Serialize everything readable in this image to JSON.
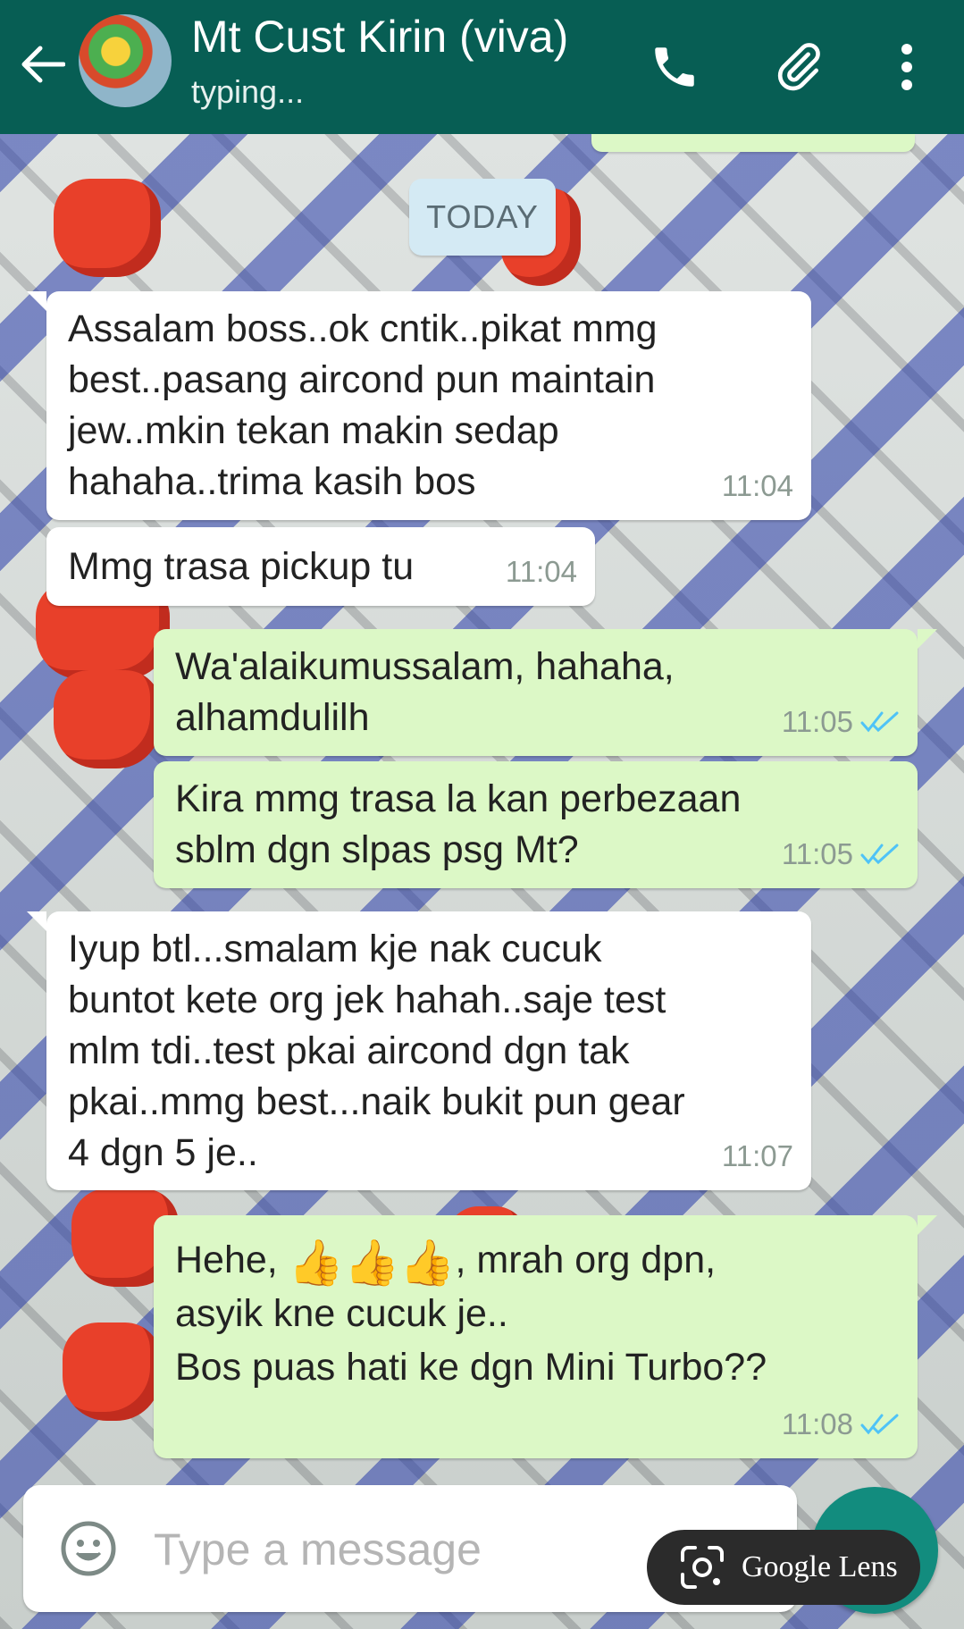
{
  "header": {
    "contact_name": "Mt Cust Kirin (viva)",
    "status": "typing...",
    "background_color": "#075e54",
    "icons": [
      "back-arrow-icon",
      "phone-icon",
      "paperclip-icon",
      "more-vert-icon"
    ]
  },
  "date_chip": "TODAY",
  "messages": [
    {
      "direction": "in",
      "text": "Assalam boss..ok cntik..pikat mmg\nbest..pasang aircond pun maintain\njew..mkin tekan makin sedap\nhahaha..trima kasih bos",
      "time": "11:04"
    },
    {
      "direction": "in",
      "text": "Mmg trasa pickup tu",
      "time": "11:04"
    },
    {
      "direction": "out",
      "text": "Wa'alaikumussalam, hahaha,\nalhamdulilh",
      "time": "11:05",
      "ticks": "double-check-icon"
    },
    {
      "direction": "out",
      "text": "Kira mmg trasa la kan perbezaan\nsblm dgn slpas psg Mt?",
      "time": "11:05",
      "ticks": "double-check-icon"
    },
    {
      "direction": "in",
      "text": "Iyup btl...smalam kje nak cucuk\nbuntot kete org jek hahah..saje test\nmlm tdi..test pkai aircond dgn tak\npkai..mmg best...naik bukit pun gear\n4 dgn 5 je..",
      "time": "11:07"
    },
    {
      "direction": "out",
      "text_start": "Hehe, ",
      "emoji": "👍👍👍",
      "text_end": ",  mrah org dpn,\nasyik kne cucuk je..\nBos puas hati ke dgn Mini Turbo??",
      "time": "11:08",
      "ticks": "double-check-icon"
    }
  ],
  "composer": {
    "placeholder": "Type a message",
    "emoji_icon": "smiley-icon"
  },
  "lens": {
    "label": "Google Lens",
    "icon": "google-lens-icon"
  },
  "colors": {
    "incoming_bubble": "#ffffff",
    "outgoing_bubble": "#dcf8c6",
    "read_ticks": "#4fc3f7"
  }
}
